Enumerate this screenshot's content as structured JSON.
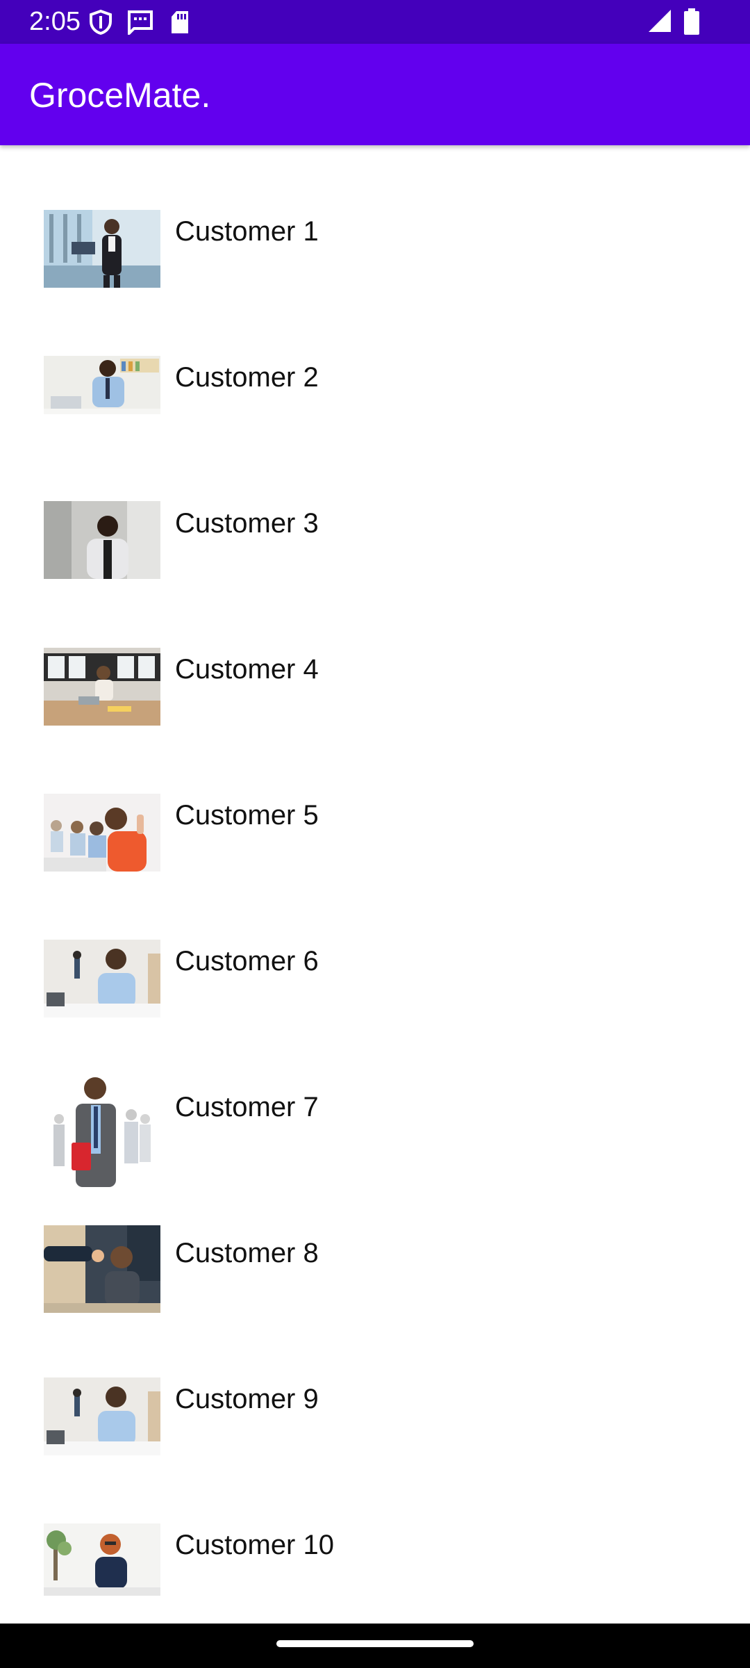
{
  "status_bar": {
    "time": "2:05",
    "icons": [
      "shield-icon",
      "message-icon",
      "sd-card-icon",
      "signal-icon",
      "battery-icon"
    ]
  },
  "app_bar": {
    "title": "GroceMate.",
    "color": "#6200ee"
  },
  "customers": [
    {
      "name": "Customer 1",
      "photo": "woman-in-suit-office-photo"
    },
    {
      "name": "Customer 2",
      "photo": "man-at-laptop-photo"
    },
    {
      "name": "Customer 3",
      "photo": "woman-in-blazer-photo"
    },
    {
      "name": "Customer 4",
      "photo": "man-at-desk-office-photo"
    },
    {
      "name": "Customer 5",
      "photo": "woman-thumbs-up-photo"
    },
    {
      "name": "Customer 6",
      "photo": "smiling-man-at-desk-photo"
    },
    {
      "name": "Customer 7",
      "photo": "man-in-suit-with-folder-photo"
    },
    {
      "name": "Customer 8",
      "photo": "woman-handshake-photo"
    },
    {
      "name": "Customer 9",
      "photo": "smiling-man-at-desk-photo"
    },
    {
      "name": "Customer 10",
      "photo": "woman-with-glasses-photo"
    }
  ]
}
